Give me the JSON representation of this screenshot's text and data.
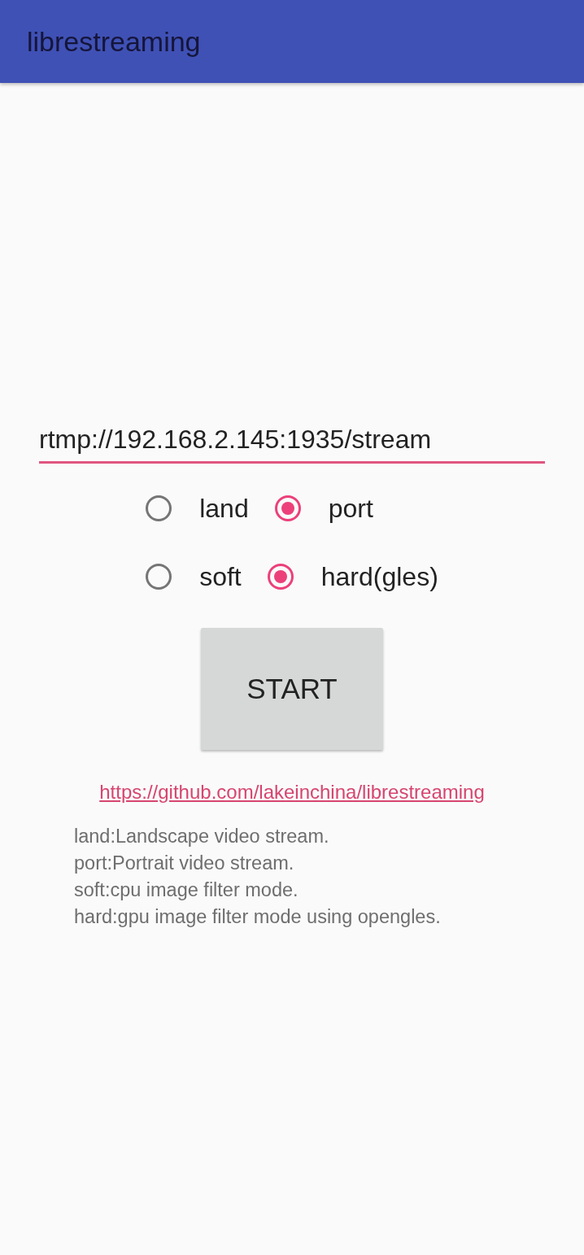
{
  "app_bar": {
    "title": "librestreaming"
  },
  "url_field": {
    "value": "rtmp://192.168.2.145:1935/stream"
  },
  "radio_groups": [
    {
      "options": [
        {
          "label": "land",
          "selected": false
        },
        {
          "label": "port",
          "selected": true
        }
      ]
    },
    {
      "options": [
        {
          "label": "soft",
          "selected": false
        },
        {
          "label": "hard(gles)",
          "selected": true
        }
      ]
    }
  ],
  "start_button": {
    "label": "START"
  },
  "link": "https://github.com/lakeinchina/librestreaming",
  "description": [
    "land:Landscape video stream.",
    "port:Portrait video stream.",
    "soft:cpu image filter mode.",
    "hard:gpu image filter mode using opengles."
  ]
}
